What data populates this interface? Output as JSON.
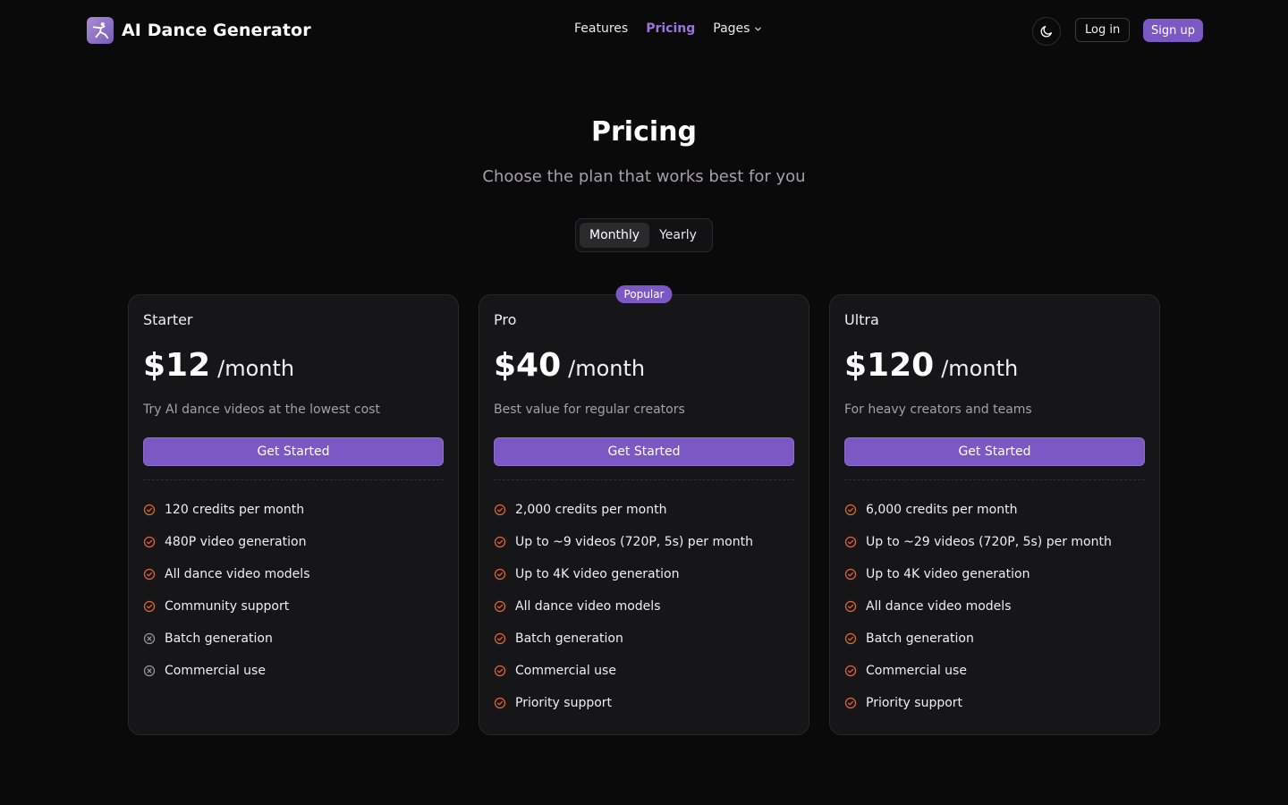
{
  "nav": {
    "brand": "AI Dance Generator",
    "links": [
      {
        "label": "Features",
        "active": false
      },
      {
        "label": "Pricing",
        "active": true
      },
      {
        "label": "Pages",
        "active": false
      }
    ],
    "login": "Log in",
    "signup": "Sign up",
    "theme_icon": "moon-icon"
  },
  "header": {
    "title": "Pricing",
    "subtitle": "Choose the plan that works best for you",
    "toggle": {
      "options": [
        "Monthly",
        "Yearly"
      ],
      "selected": "Monthly"
    }
  },
  "plans": [
    {
      "name": "Starter",
      "price": "$12",
      "period": "/month",
      "description": "Try AI dance videos at the lowest cost",
      "cta": "Get Started",
      "popular": false,
      "features": [
        {
          "text": "120 credits per month",
          "included": true
        },
        {
          "text": "480P video generation",
          "included": true
        },
        {
          "text": "All dance video models",
          "included": true
        },
        {
          "text": "Community support",
          "included": true
        },
        {
          "text": "Batch generation",
          "included": false
        },
        {
          "text": "Commercial use",
          "included": false
        }
      ]
    },
    {
      "name": "Pro",
      "price": "$40",
      "period": "/month",
      "description": "Best value for regular creators",
      "cta": "Get Started",
      "popular": true,
      "badge": "Popular",
      "features": [
        {
          "text": "2,000 credits per month",
          "included": true
        },
        {
          "text": "Up to ~9 videos (720P, 5s) per month",
          "included": true
        },
        {
          "text": "Up to 4K video generation",
          "included": true
        },
        {
          "text": "All dance video models",
          "included": true
        },
        {
          "text": "Batch generation",
          "included": true
        },
        {
          "text": "Commercial use",
          "included": true
        },
        {
          "text": "Priority support",
          "included": true
        }
      ]
    },
    {
      "name": "Ultra",
      "price": "$120",
      "period": "/month",
      "description": "For heavy creators and teams",
      "cta": "Get Started",
      "popular": false,
      "features": [
        {
          "text": "6,000 credits per month",
          "included": true
        },
        {
          "text": "Up to ~29 videos (720P, 5s) per month",
          "included": true
        },
        {
          "text": "Up to 4K video generation",
          "included": true
        },
        {
          "text": "All dance video models",
          "included": true
        },
        {
          "text": "Batch generation",
          "included": true
        },
        {
          "text": "Commercial use",
          "included": true
        },
        {
          "text": "Priority support",
          "included": true
        }
      ]
    }
  ],
  "colors": {
    "background": "#0b0a0b",
    "card": "#161517",
    "accent": "#7c58c4",
    "nav_active": "#9c74e0",
    "check": "#e8662c",
    "cross": "#9a989c"
  }
}
